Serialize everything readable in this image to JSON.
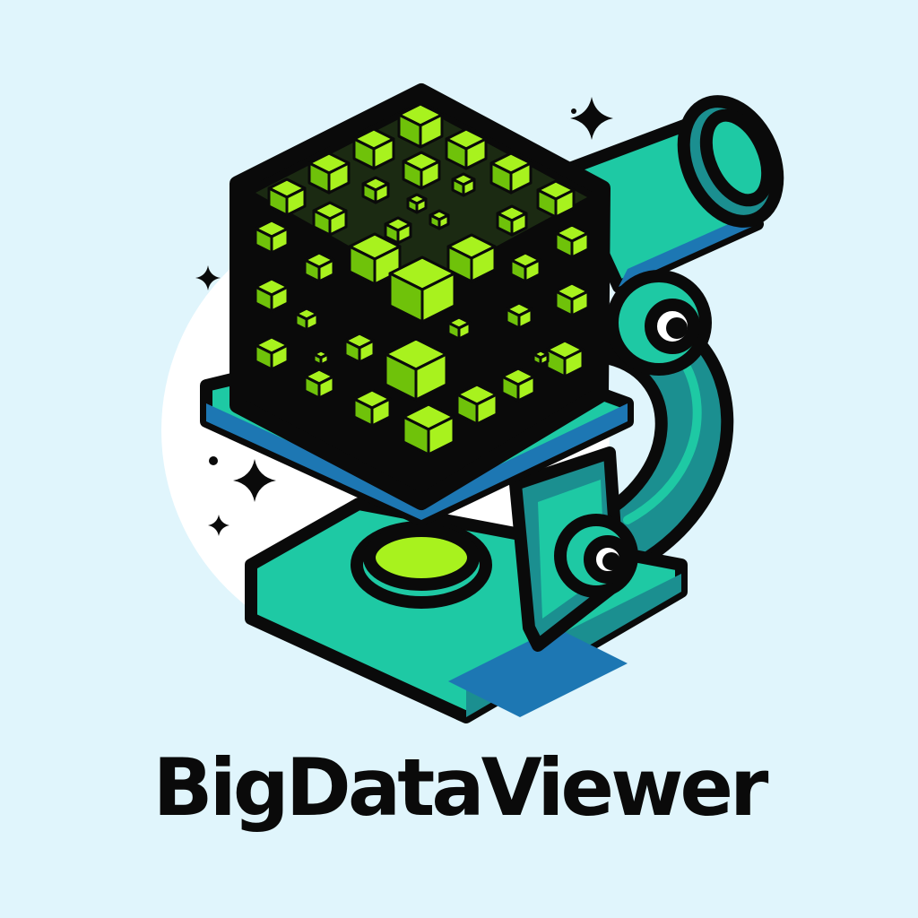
{
  "logo": {
    "wordmark": "BigDataViewer",
    "icon": "microscope-data-cube-icon"
  },
  "colors": {
    "background": "#e0f5fc",
    "teal": "#1ec9a4",
    "teal_dark": "#1b8f90",
    "blue_shadow": "#1d77b3",
    "lime": "#a8f21e",
    "lime_dark": "#6fc20a",
    "outline": "#0a0a0a"
  }
}
